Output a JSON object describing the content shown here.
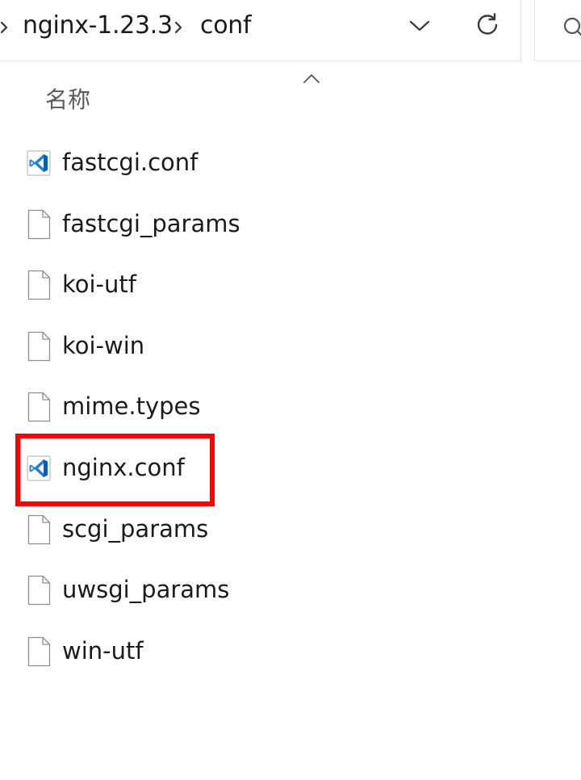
{
  "address_bar": {
    "breadcrumbs": [
      "nginx-1.23.3",
      "conf"
    ],
    "history_dropdown_icon": "chevron-down-icon",
    "refresh_icon": "refresh-icon"
  },
  "search": {
    "icon": "search-icon"
  },
  "columns": {
    "name_header": "名称",
    "sort_icon": "sort-ascending-icon"
  },
  "files": [
    {
      "name": "fastcgi.conf",
      "icon": "vscode-file-icon"
    },
    {
      "name": "fastcgi_params",
      "icon": "blank-file-icon"
    },
    {
      "name": "koi-utf",
      "icon": "blank-file-icon"
    },
    {
      "name": "koi-win",
      "icon": "blank-file-icon"
    },
    {
      "name": "mime.types",
      "icon": "blank-file-icon"
    },
    {
      "name": "nginx.conf",
      "icon": "vscode-file-icon",
      "highlighted": true
    },
    {
      "name": "scgi_params",
      "icon": "blank-file-icon"
    },
    {
      "name": "uwsgi_params",
      "icon": "blank-file-icon"
    },
    {
      "name": "win-utf",
      "icon": "blank-file-icon"
    }
  ],
  "colors": {
    "highlight": "#ff0000",
    "vscode_blue": "#1f7fd4",
    "vscode_dark": "#0b5fa8"
  }
}
